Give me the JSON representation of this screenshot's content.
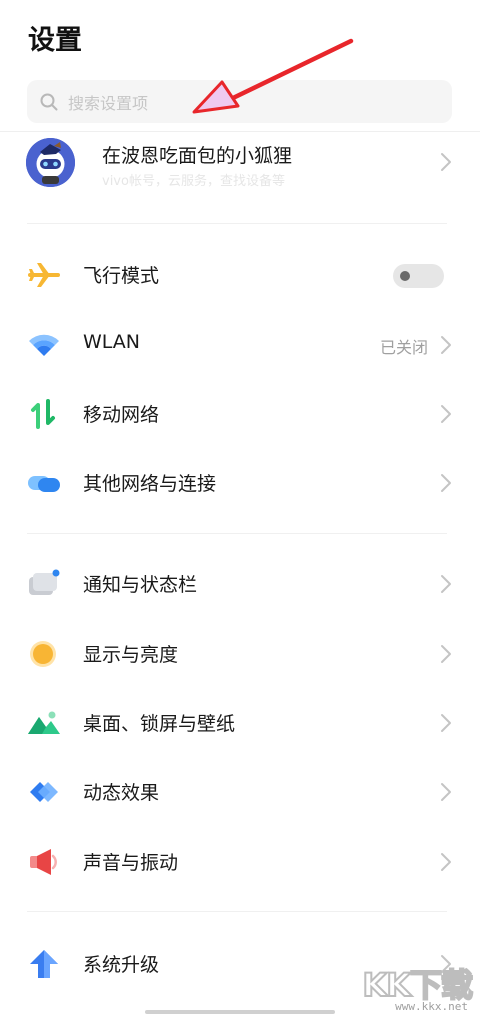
{
  "header": {
    "title": "设置"
  },
  "search": {
    "placeholder": "搜索设置项"
  },
  "account": {
    "name": "在波恩吃面包的小狐狸",
    "subtitle": "vivo帐号，云服务，查找设备等"
  },
  "groups": [
    {
      "items": [
        {
          "label": "飞行模式",
          "icon": "airplane-icon",
          "toggle": false
        },
        {
          "label": "WLAN",
          "icon": "wifi-icon",
          "value": "已关闭"
        },
        {
          "label": "移动网络",
          "icon": "mobile-network-icon"
        },
        {
          "label": "其他网络与连接",
          "icon": "connections-icon"
        }
      ]
    },
    {
      "items": [
        {
          "label": "通知与状态栏",
          "icon": "notification-icon"
        },
        {
          "label": "显示与亮度",
          "icon": "brightness-icon"
        },
        {
          "label": "桌面、锁屏与壁纸",
          "icon": "wallpaper-icon"
        },
        {
          "label": "动态效果",
          "icon": "animation-icon"
        },
        {
          "label": "声音与振动",
          "icon": "sound-icon"
        }
      ]
    },
    {
      "items": [
        {
          "label": "系统升级",
          "icon": "system-update-icon"
        }
      ]
    }
  ],
  "watermark": {
    "text": "KK下载",
    "url": "www.kkx.net"
  },
  "colors": {
    "accent_blue": "#3a7df0",
    "airplane_yellow": "#f7b733",
    "annotation_arrow_red": "#e8262b"
  }
}
